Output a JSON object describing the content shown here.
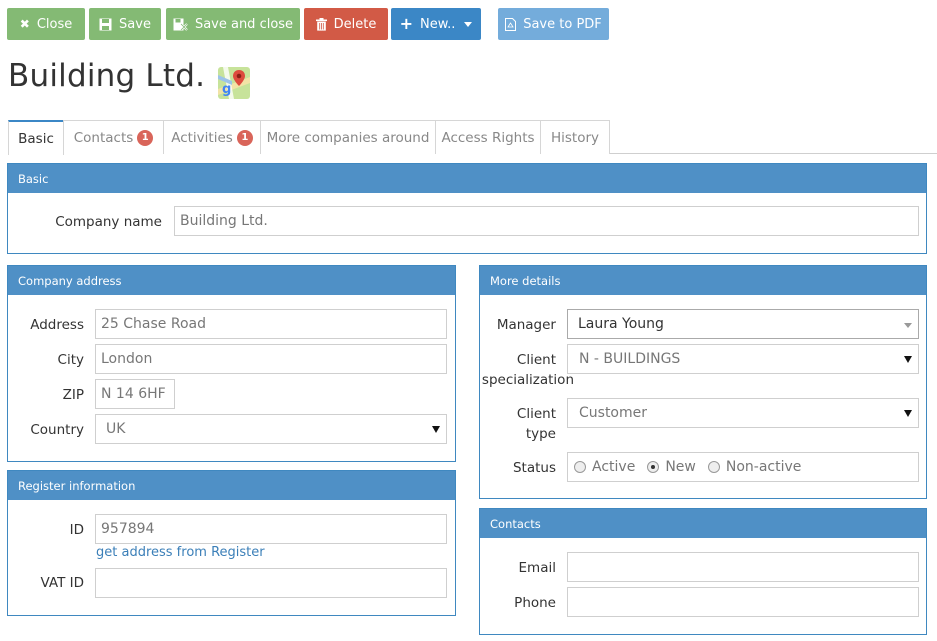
{
  "toolbar": {
    "close_label": "Close",
    "save_label": "Save",
    "save_close_label": "Save and close",
    "delete_label": "Delete",
    "new_label": "New..",
    "pdf_label": "Save to PDF"
  },
  "page": {
    "title": "Building Ltd."
  },
  "tabs": [
    {
      "label": "Basic",
      "badge": ""
    },
    {
      "label": "Contacts",
      "badge": "1"
    },
    {
      "label": "Activities",
      "badge": "1"
    },
    {
      "label": "More companies around",
      "badge": ""
    },
    {
      "label": "Access Rights",
      "badge": ""
    },
    {
      "label": "History",
      "badge": ""
    }
  ],
  "basic": {
    "header": "Basic",
    "company_name_label": "Company name",
    "company_name_value": "Building Ltd."
  },
  "address": {
    "header": "Company address",
    "address_label": "Address",
    "address_value": "25 Chase Road",
    "city_label": "City",
    "city_value": "London",
    "zip_label": "ZIP",
    "zip_value": "N 14 6HF",
    "country_label": "Country",
    "country_value": "UK"
  },
  "register": {
    "header": "Register information",
    "id_label": "ID",
    "id_value": "957894",
    "register_link": "get address from Register",
    "vat_label": "VAT ID",
    "vat_value": ""
  },
  "details": {
    "header": "More details",
    "manager_label": "Manager",
    "manager_value": "Laura Young",
    "specialization_label_1": "Client",
    "specialization_label_2": "specialization",
    "specialization_value": "N - BUILDINGS",
    "type_label_1": "Client",
    "type_label_2": "type",
    "type_value": "Customer",
    "status_label": "Status",
    "status_options": [
      "Active",
      "New",
      "Non-active"
    ],
    "status_selected": "New"
  },
  "contacts": {
    "header": "Contacts",
    "email_label": "Email",
    "email_value": "",
    "phone_label": "Phone",
    "phone_value": ""
  },
  "colors": {
    "green": "#84ba74",
    "red": "#d25a46",
    "blue": "#3b87c6",
    "light_blue": "#74acdb",
    "panel_header": "#4f90c6",
    "badge": "#d9655a"
  }
}
